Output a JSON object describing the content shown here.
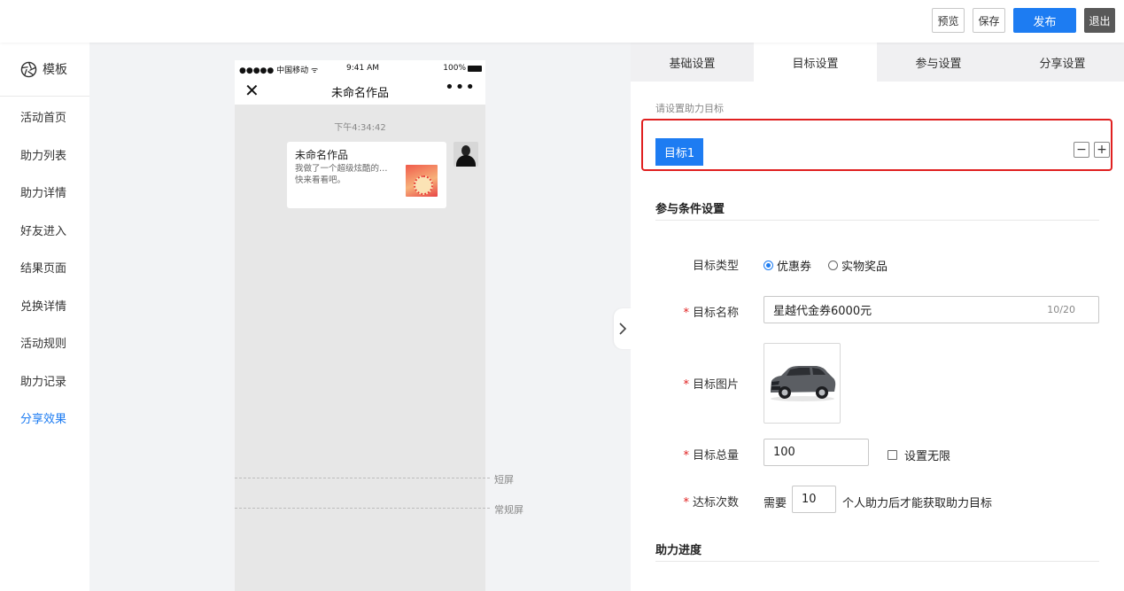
{
  "header": {
    "preview_label": "预览",
    "save_label": "保存",
    "publish_label": "发布",
    "exit_label": "退出"
  },
  "sidebar": {
    "template_label": "模板",
    "items": [
      {
        "label": "活动首页",
        "active": false
      },
      {
        "label": "助力列表",
        "active": false
      },
      {
        "label": "助力详情",
        "active": false
      },
      {
        "label": "好友进入",
        "active": false
      },
      {
        "label": "结果页面",
        "active": false
      },
      {
        "label": "兑换详情",
        "active": false
      },
      {
        "label": "活动规则",
        "active": false
      },
      {
        "label": "助力记录",
        "active": false
      },
      {
        "label": "分享效果",
        "active": true
      }
    ]
  },
  "preview": {
    "status": {
      "carrier": "●●●●● 中国移动 ᯤ",
      "time": "9:41 AM",
      "battery": "100%"
    },
    "nav_title": "未命名作品",
    "chat_time": "下午4:34:42",
    "card": {
      "title": "未命名作品",
      "desc_line1": "我做了一个超级炫酷的…",
      "desc_line2": "快来看看吧。"
    },
    "markers": {
      "short_screen": "短屏",
      "regular_screen": "常规屏"
    }
  },
  "panel": {
    "tabs": [
      {
        "label": "基础设置",
        "active": false
      },
      {
        "label": "目标设置",
        "active": true
      },
      {
        "label": "参与设置",
        "active": false
      },
      {
        "label": "分享设置",
        "active": false
      }
    ],
    "hint": "请设置助力目标",
    "target_tag": "目标1",
    "minus_label": "−",
    "plus_label": "+",
    "section_conditions": "参与条件设置",
    "target_type": {
      "label": "目标类型",
      "options": [
        "优惠券",
        "实物奖品"
      ],
      "selected": "优惠券"
    },
    "target_name": {
      "label": "目标名称",
      "value": "星越代金券6000元",
      "count": "10/20"
    },
    "target_image": {
      "label": "目标图片"
    },
    "target_total": {
      "label": "目标总量",
      "value": "100",
      "unlimited_label": "设置无限"
    },
    "reach_count": {
      "label": "达标次数",
      "prefix": "需要",
      "value": "10",
      "suffix": "个人助力后才能获取助力目标"
    },
    "section_progress": "助力进度"
  },
  "colors": {
    "accent": "#1d7cf2",
    "highlight_border": "#e02020",
    "exit_bg": "#595959"
  }
}
